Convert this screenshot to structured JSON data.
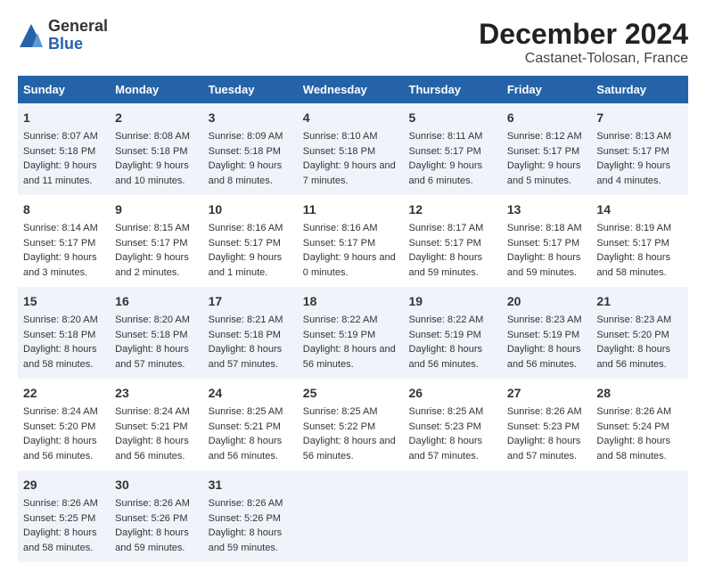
{
  "logo": {
    "general": "General",
    "blue": "Blue"
  },
  "title": "December 2024",
  "subtitle": "Castanet-Tolosan, France",
  "weekdays": [
    "Sunday",
    "Monday",
    "Tuesday",
    "Wednesday",
    "Thursday",
    "Friday",
    "Saturday"
  ],
  "weeks": [
    [
      {
        "day": "1",
        "sunrise": "8:07 AM",
        "sunset": "5:18 PM",
        "daylight": "9 hours and 11 minutes."
      },
      {
        "day": "2",
        "sunrise": "8:08 AM",
        "sunset": "5:18 PM",
        "daylight": "9 hours and 10 minutes."
      },
      {
        "day": "3",
        "sunrise": "8:09 AM",
        "sunset": "5:18 PM",
        "daylight": "9 hours and 8 minutes."
      },
      {
        "day": "4",
        "sunrise": "8:10 AM",
        "sunset": "5:18 PM",
        "daylight": "9 hours and 7 minutes."
      },
      {
        "day": "5",
        "sunrise": "8:11 AM",
        "sunset": "5:17 PM",
        "daylight": "9 hours and 6 minutes."
      },
      {
        "day": "6",
        "sunrise": "8:12 AM",
        "sunset": "5:17 PM",
        "daylight": "9 hours and 5 minutes."
      },
      {
        "day": "7",
        "sunrise": "8:13 AM",
        "sunset": "5:17 PM",
        "daylight": "9 hours and 4 minutes."
      }
    ],
    [
      {
        "day": "8",
        "sunrise": "8:14 AM",
        "sunset": "5:17 PM",
        "daylight": "9 hours and 3 minutes."
      },
      {
        "day": "9",
        "sunrise": "8:15 AM",
        "sunset": "5:17 PM",
        "daylight": "9 hours and 2 minutes."
      },
      {
        "day": "10",
        "sunrise": "8:16 AM",
        "sunset": "5:17 PM",
        "daylight": "9 hours and 1 minute."
      },
      {
        "day": "11",
        "sunrise": "8:16 AM",
        "sunset": "5:17 PM",
        "daylight": "9 hours and 0 minutes."
      },
      {
        "day": "12",
        "sunrise": "8:17 AM",
        "sunset": "5:17 PM",
        "daylight": "8 hours and 59 minutes."
      },
      {
        "day": "13",
        "sunrise": "8:18 AM",
        "sunset": "5:17 PM",
        "daylight": "8 hours and 59 minutes."
      },
      {
        "day": "14",
        "sunrise": "8:19 AM",
        "sunset": "5:17 PM",
        "daylight": "8 hours and 58 minutes."
      }
    ],
    [
      {
        "day": "15",
        "sunrise": "8:20 AM",
        "sunset": "5:18 PM",
        "daylight": "8 hours and 58 minutes."
      },
      {
        "day": "16",
        "sunrise": "8:20 AM",
        "sunset": "5:18 PM",
        "daylight": "8 hours and 57 minutes."
      },
      {
        "day": "17",
        "sunrise": "8:21 AM",
        "sunset": "5:18 PM",
        "daylight": "8 hours and 57 minutes."
      },
      {
        "day": "18",
        "sunrise": "8:22 AM",
        "sunset": "5:19 PM",
        "daylight": "8 hours and 56 minutes."
      },
      {
        "day": "19",
        "sunrise": "8:22 AM",
        "sunset": "5:19 PM",
        "daylight": "8 hours and 56 minutes."
      },
      {
        "day": "20",
        "sunrise": "8:23 AM",
        "sunset": "5:19 PM",
        "daylight": "8 hours and 56 minutes."
      },
      {
        "day": "21",
        "sunrise": "8:23 AM",
        "sunset": "5:20 PM",
        "daylight": "8 hours and 56 minutes."
      }
    ],
    [
      {
        "day": "22",
        "sunrise": "8:24 AM",
        "sunset": "5:20 PM",
        "daylight": "8 hours and 56 minutes."
      },
      {
        "day": "23",
        "sunrise": "8:24 AM",
        "sunset": "5:21 PM",
        "daylight": "8 hours and 56 minutes."
      },
      {
        "day": "24",
        "sunrise": "8:25 AM",
        "sunset": "5:21 PM",
        "daylight": "8 hours and 56 minutes."
      },
      {
        "day": "25",
        "sunrise": "8:25 AM",
        "sunset": "5:22 PM",
        "daylight": "8 hours and 56 minutes."
      },
      {
        "day": "26",
        "sunrise": "8:25 AM",
        "sunset": "5:23 PM",
        "daylight": "8 hours and 57 minutes."
      },
      {
        "day": "27",
        "sunrise": "8:26 AM",
        "sunset": "5:23 PM",
        "daylight": "8 hours and 57 minutes."
      },
      {
        "day": "28",
        "sunrise": "8:26 AM",
        "sunset": "5:24 PM",
        "daylight": "8 hours and 58 minutes."
      }
    ],
    [
      {
        "day": "29",
        "sunrise": "8:26 AM",
        "sunset": "5:25 PM",
        "daylight": "8 hours and 58 minutes."
      },
      {
        "day": "30",
        "sunrise": "8:26 AM",
        "sunset": "5:26 PM",
        "daylight": "8 hours and 59 minutes."
      },
      {
        "day": "31",
        "sunrise": "8:26 AM",
        "sunset": "5:26 PM",
        "daylight": "8 hours and 59 minutes."
      },
      null,
      null,
      null,
      null
    ]
  ],
  "labels": {
    "sunrise": "Sunrise:",
    "sunset": "Sunset:",
    "daylight": "Daylight:"
  }
}
